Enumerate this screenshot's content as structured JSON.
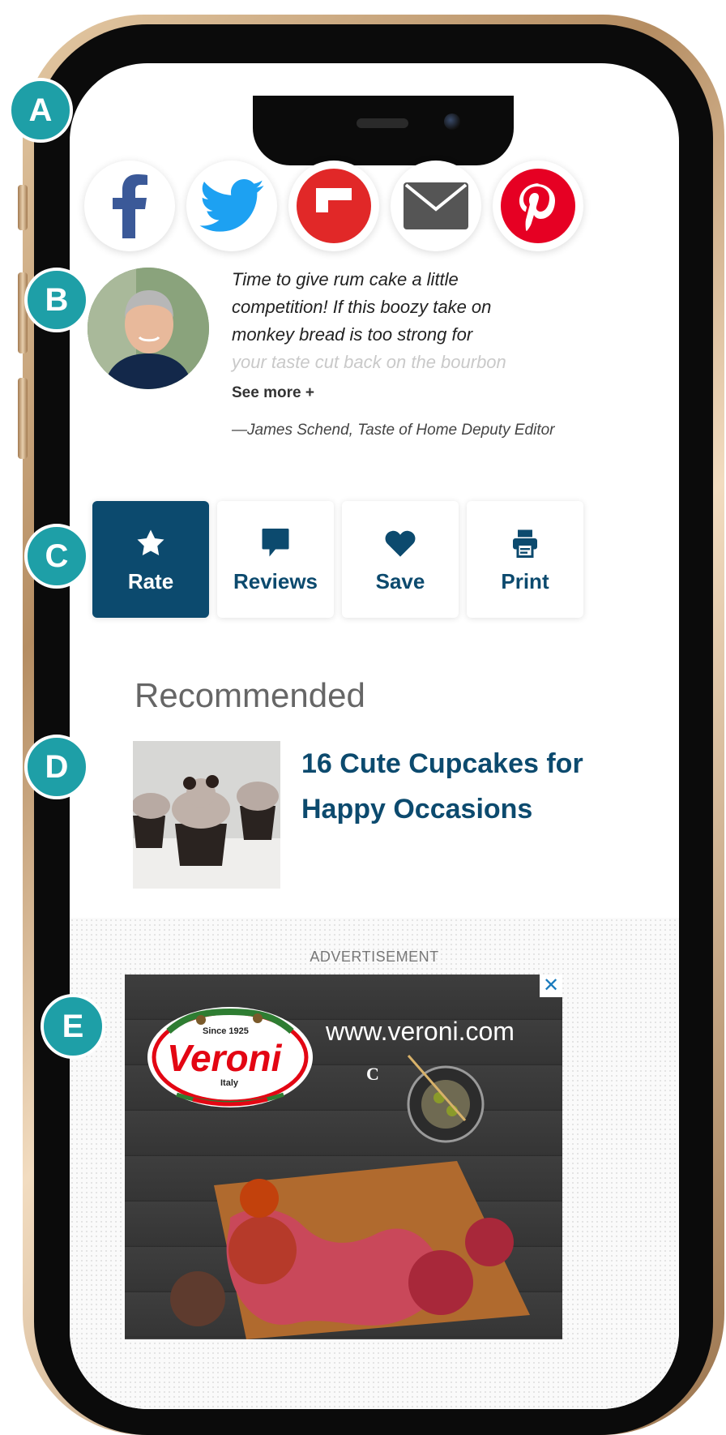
{
  "callouts": [
    "A",
    "B",
    "C",
    "D",
    "E"
  ],
  "share": {
    "buttons": [
      {
        "name": "facebook",
        "icon": "facebook-icon",
        "color": "#3b5998"
      },
      {
        "name": "twitter",
        "icon": "twitter-icon",
        "color": "#1da1f2"
      },
      {
        "name": "flipboard",
        "icon": "flipboard-icon",
        "color": "#e12828"
      },
      {
        "name": "email",
        "icon": "envelope-icon",
        "color": "#555555"
      },
      {
        "name": "pinterest",
        "icon": "pinterest-icon",
        "color": "#e60023"
      }
    ]
  },
  "blurb": {
    "quote_lines": [
      "Time to give rum cake a little",
      "competition! If this boozy take on",
      "monkey bread is too strong for",
      "your taste cut back on the bourbon"
    ],
    "see_more": "See more +",
    "attribution": "—James Schend, Taste of Home Deputy Editor"
  },
  "actions": [
    {
      "label": "Rate",
      "icon": "star-icon"
    },
    {
      "label": "Reviews",
      "icon": "comment-icon"
    },
    {
      "label": "Save",
      "icon": "heart-icon"
    },
    {
      "label": "Print",
      "icon": "printer-icon"
    }
  ],
  "recommended": {
    "heading": "Recommended",
    "item_title": "16 Cute Cupcakes for Happy Occasions"
  },
  "ad": {
    "label": "ADVERTISEMENT",
    "close": "✕",
    "url": "www.veroni.com",
    "c_mark": "C",
    "logo": {
      "since": "Since 1925",
      "brand": "Veroni",
      "origin": "Italy"
    }
  },
  "colors": {
    "accent": "#0c4a6e",
    "badge": "#1e9fa7"
  }
}
